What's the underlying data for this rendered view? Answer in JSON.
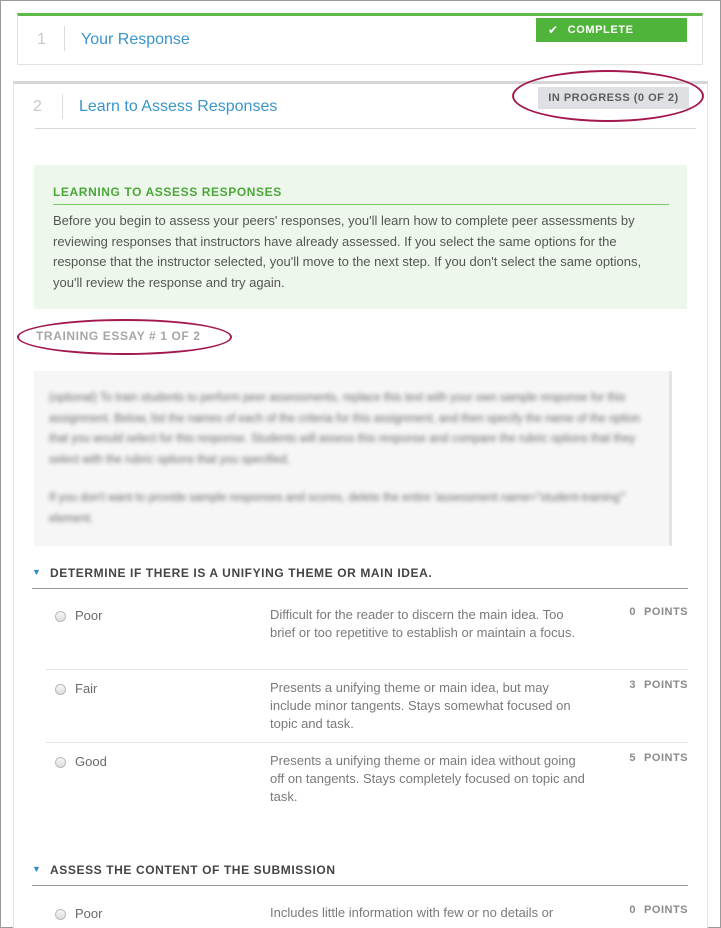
{
  "step1": {
    "number": "1",
    "title": "Your Response",
    "status": "COMPLETE",
    "status_icon": "check-icon"
  },
  "step2": {
    "number": "2",
    "title": "Learn to Assess Responses",
    "status": "IN PROGRESS (0 OF 2)",
    "learning": {
      "title": "LEARNING TO ASSESS RESPONSES",
      "text": "Before you begin to assess your peers' responses, you'll learn how to complete peer assessments by reviewing responses that instructors have already assessed. If you select the same options for the response that the instructor selected, you'll move to the next step. If you don't select the same options, you'll review the response and try again."
    },
    "training_label": "TRAINING ESSAY # 1 OF 2",
    "essay": {
      "paragraph1": "(optional) To train students to perform peer assessments, replace this text with your own sample response for this assignment. Below, list the names of each of the criteria for this assignment, and then specify the name of the option that you would select for this response. Students will assess this response and compare the rubric options that they select with the rubric options that you specified.",
      "paragraph2": "If you don't want to provide sample responses and scores, delete the entire 'assessment name=\"student-training\"' element."
    },
    "criteria": [
      {
        "title": "DETERMINE IF THERE IS A UNIFYING THEME OR MAIN IDEA.",
        "options": [
          {
            "label": "Poor",
            "description": "Difficult for the reader to discern the main idea. Too brief or too repetitive to establish or maintain a focus.",
            "points": "0",
            "points_label": "POINTS"
          },
          {
            "label": "Fair",
            "description": "Presents a unifying theme or main idea, but may include minor tangents. Stays somewhat focused on topic and task.",
            "points": "3",
            "points_label": "POINTS"
          },
          {
            "label": "Good",
            "description": "Presents a unifying theme or main idea without going off on tangents. Stays completely focused on topic and task.",
            "points": "5",
            "points_label": "POINTS"
          }
        ]
      },
      {
        "title": "ASSESS THE CONTENT OF THE SUBMISSION",
        "options": [
          {
            "label": "Poor",
            "description": "Includes little information with few or no details or",
            "points": "0",
            "points_label": "POINTS"
          }
        ]
      }
    ]
  },
  "colors": {
    "complete_green": "#4fb43a",
    "link_blue": "#3a95c9",
    "annotation_ellipse": "#a3184f",
    "learning_bg": "#eef7ec"
  }
}
